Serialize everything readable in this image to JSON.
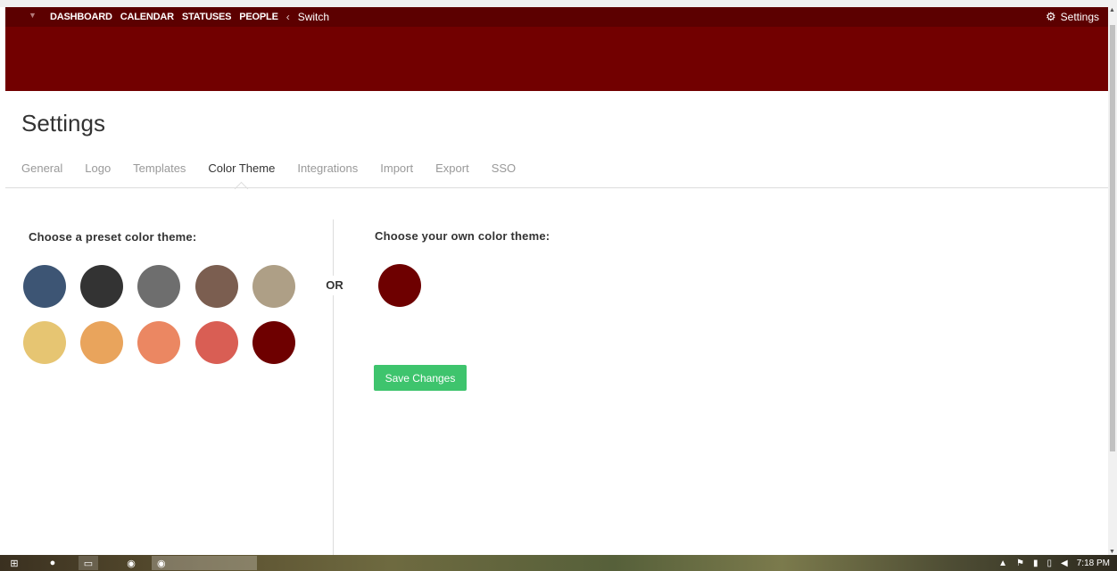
{
  "nav": {
    "links": [
      "DASHBOARD",
      "CALENDAR",
      "STATUSES",
      "PEOPLE"
    ],
    "switch_label": "Switch",
    "settings_label": "Settings",
    "colors": {
      "nav_bar": "#5c0000",
      "banner": "#720000"
    }
  },
  "page": {
    "title": "Settings",
    "tabs": [
      "General",
      "Logo",
      "Templates",
      "Color Theme",
      "Integrations",
      "Import",
      "Export",
      "SSO"
    ],
    "active_tab": "Color Theme"
  },
  "preset": {
    "heading": "Choose a preset color theme:",
    "swatches": [
      "#3d5574",
      "#333333",
      "#6e6e6e",
      "#7b5e50",
      "#ae9f86",
      "#e6c572",
      "#e9a45c",
      "#eb8762",
      "#d95e54",
      "#6e0000"
    ]
  },
  "or_label": "OR",
  "own": {
    "heading": "Choose your own color theme:",
    "color": "#6e0000"
  },
  "save_button": {
    "label": "Save Changes",
    "color": "#3ec46d"
  },
  "taskbar": {
    "clock": "7:18 PM"
  }
}
